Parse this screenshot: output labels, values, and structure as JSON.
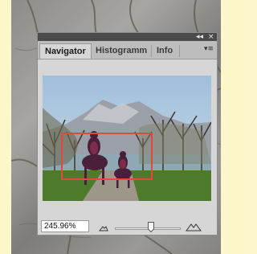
{
  "panel": {
    "title_buttons": {
      "collapse_glyph": "◂◂",
      "close_glyph": "×"
    },
    "tabs": [
      {
        "label": "Navigator",
        "active": true
      },
      {
        "label": "Histogramm",
        "active": false
      },
      {
        "label": "Info",
        "active": false
      }
    ],
    "menu_glyph": "▾≡"
  },
  "zoom": {
    "value": "245.96%",
    "slider_level_percent": 60
  },
  "icons": {
    "collapse": "double-chevron-icon",
    "close": "close-icon",
    "panel_menu": "panel-menu-icon",
    "zoom_out": "mountain-small-icon",
    "zoom_in": "mountain-large-icon"
  },
  "colors": {
    "view_box": "#e0493d",
    "panel_bg": "#d6d6d6",
    "title_bar": "#4a4a4a"
  }
}
